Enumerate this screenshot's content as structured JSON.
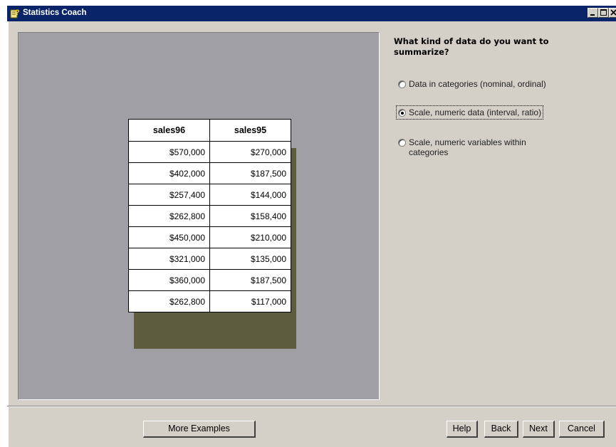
{
  "window": {
    "title": "Statistics Coach",
    "title_icon": "coach-app-icon",
    "controls": [
      "minimize-icon",
      "maximize-icon",
      "close-icon"
    ]
  },
  "example_table": {
    "headers": [
      "sales96",
      "sales95"
    ],
    "rows": [
      [
        "$570,000",
        "$270,000"
      ],
      [
        "$402,000",
        "$187,500"
      ],
      [
        "$257,400",
        "$144,000"
      ],
      [
        "$262,800",
        "$158,400"
      ],
      [
        "$450,000",
        "$210,000"
      ],
      [
        "$321,000",
        "$135,000"
      ],
      [
        "$360,000",
        "$187,500"
      ],
      [
        "$262,800",
        "$117,000"
      ]
    ]
  },
  "question": {
    "text": "What kind of data do you want to summarize?",
    "options": [
      {
        "label": "Data in categories (nominal, ordinal)",
        "selected": false
      },
      {
        "label": "Scale, numeric data (interval, ratio)",
        "selected": true
      },
      {
        "label": "Scale, numeric variables within categories",
        "selected": false
      }
    ]
  },
  "buttons": {
    "more_examples": "More Examples",
    "help": "Help",
    "back": "Back",
    "next": "Next",
    "cancel": "Cancel"
  },
  "colors": {
    "titlebar": "#0a246a",
    "dialog_bg": "#d4d0c8",
    "example_panel": "#a09fa6",
    "table_shadow": "#5d5c3e"
  }
}
